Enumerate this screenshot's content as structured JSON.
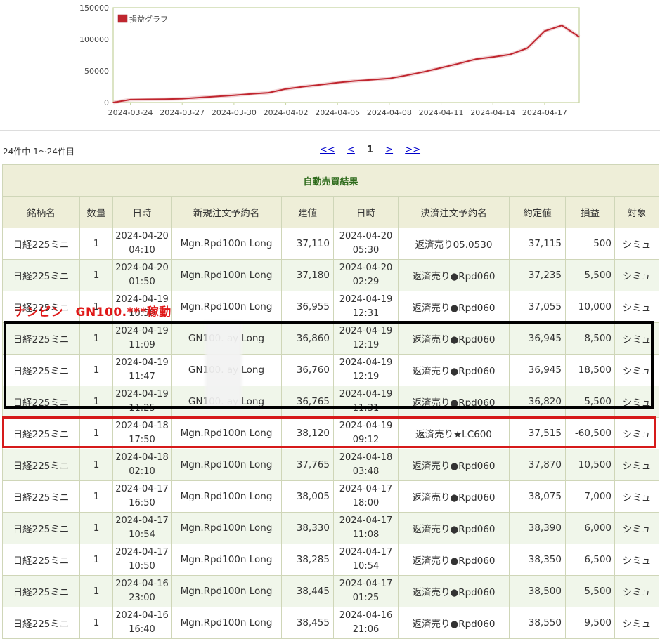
{
  "chart_data": {
    "type": "line",
    "title": "",
    "xlabel": "",
    "ylabel": "",
    "ylim": [
      0,
      150000
    ],
    "yticks": [
      "150000",
      "100000",
      "50000",
      "0"
    ],
    "xticks": [
      "2024-03-24",
      "2024-03-27",
      "2024-03-30",
      "2024-04-02",
      "2024-04-05",
      "2024-04-08",
      "2024-04-11",
      "2024-04-14",
      "2024-04-17"
    ],
    "grid": false,
    "legend": "top-left",
    "series": [
      {
        "name": "損益グラフ",
        "color": "#c0262f",
        "x": [
          "2024-03-23",
          "2024-03-24",
          "2024-03-25",
          "2024-03-26",
          "2024-03-27",
          "2024-03-28",
          "2024-03-29",
          "2024-03-30",
          "2024-03-31",
          "2024-04-01",
          "2024-04-02",
          "2024-04-03",
          "2024-04-04",
          "2024-04-05",
          "2024-04-06",
          "2024-04-07",
          "2024-04-08",
          "2024-04-09",
          "2024-04-10",
          "2024-04-11",
          "2024-04-12",
          "2024-04-13",
          "2024-04-14",
          "2024-04-15",
          "2024-04-16",
          "2024-04-17",
          "2024-04-18",
          "2024-04-19"
        ],
        "values": [
          0,
          4500,
          5000,
          5200,
          6000,
          7800,
          9500,
          11500,
          13500,
          15500,
          21500,
          25000,
          28000,
          31500,
          34000,
          36000,
          38000,
          43000,
          48500,
          55000,
          61500,
          68500,
          72000,
          76000,
          86000,
          113000,
          122000,
          104000
        ]
      }
    ]
  },
  "list": {
    "count_text": "24件中 1～24件目",
    "pager": {
      "first": "<<",
      "prev": "<",
      "current": "1",
      "next": ">",
      "last": ">>"
    }
  },
  "table": {
    "caption": "自動売買結果",
    "headers": [
      "銘柄名",
      "数量",
      "日時",
      "新規注文予約名",
      "建値",
      "日時",
      "決済注文予約名",
      "約定値",
      "損益",
      "対象"
    ],
    "rows": [
      {
        "symbol": "日経225ミニ",
        "qty": "1",
        "open_date": "2024-04-20",
        "open_time": "04:10",
        "entry_name": "Mgn.Rpd100n Long",
        "entry_price": "37,110",
        "close_date": "2024-04-20",
        "close_time": "05:30",
        "exit_name": "返済売り05.0530",
        "exit_price": "37,115",
        "pl": "500",
        "target": "シミュ"
      },
      {
        "symbol": "日経225ミニ",
        "qty": "1",
        "open_date": "2024-04-20",
        "open_time": "01:50",
        "entry_name": "Mgn.Rpd100n Long",
        "entry_price": "37,180",
        "close_date": "2024-04-20",
        "close_time": "02:29",
        "exit_name": "返済売り●Rpd060",
        "exit_price": "37,235",
        "pl": "5,500",
        "target": "シミュ"
      },
      {
        "symbol": "日経225ミニ",
        "qty": "1",
        "open_date": "2024-04-19",
        "open_time": "10:50",
        "entry_name": "Mgn.Rpd100n Long",
        "entry_price": "36,955",
        "close_date": "2024-04-19",
        "close_time": "12:31",
        "exit_name": "返済売り●Rpd060",
        "exit_price": "37,055",
        "pl": "10,000",
        "target": "シミュ"
      },
      {
        "symbol": "日経225ミニ",
        "qty": "1",
        "open_date": "2024-04-19",
        "open_time": "11:09",
        "entry_name": "GN100.   ay Long",
        "entry_price": "36,860",
        "close_date": "2024-04-19",
        "close_time": "12:19",
        "exit_name": "返済売り●Rpd060",
        "exit_price": "36,945",
        "pl": "8,500",
        "target": "シミュ"
      },
      {
        "symbol": "日経225ミニ",
        "qty": "1",
        "open_date": "2024-04-19",
        "open_time": "11:47",
        "entry_name": "GN100.   ay Long",
        "entry_price": "36,760",
        "close_date": "2024-04-19",
        "close_time": "12:19",
        "exit_name": "返済売り●Rpd060",
        "exit_price": "36,945",
        "pl": "18,500",
        "target": "シミュ"
      },
      {
        "symbol": "日経225ミニ",
        "qty": "1",
        "open_date": "2024-04-19",
        "open_time": "11:25",
        "entry_name": "GN100.   ay Long",
        "entry_price": "36,765",
        "close_date": "2024-04-19",
        "close_time": "11:31",
        "exit_name": "返済売り●Rpd060",
        "exit_price": "36,820",
        "pl": "5,500",
        "target": "シミュ"
      },
      {
        "symbol": "日経225ミニ",
        "qty": "1",
        "open_date": "2024-04-18",
        "open_time": "17:50",
        "entry_name": "Mgn.Rpd100n Long",
        "entry_price": "38,120",
        "close_date": "2024-04-19",
        "close_time": "09:12",
        "exit_name": "返済売り★LC600",
        "exit_price": "37,515",
        "pl": "-60,500",
        "target": "シミュ"
      },
      {
        "symbol": "日経225ミニ",
        "qty": "1",
        "open_date": "2024-04-18",
        "open_time": "02:10",
        "entry_name": "Mgn.Rpd100n Long",
        "entry_price": "37,765",
        "close_date": "2024-04-18",
        "close_time": "03:48",
        "exit_name": "返済売り●Rpd060",
        "exit_price": "37,870",
        "pl": "10,500",
        "target": "シミュ"
      },
      {
        "symbol": "日経225ミニ",
        "qty": "1",
        "open_date": "2024-04-17",
        "open_time": "16:50",
        "entry_name": "Mgn.Rpd100n Long",
        "entry_price": "38,005",
        "close_date": "2024-04-17",
        "close_time": "18:00",
        "exit_name": "返済売り●Rpd060",
        "exit_price": "38,075",
        "pl": "7,000",
        "target": "シミュ"
      },
      {
        "symbol": "日経225ミニ",
        "qty": "1",
        "open_date": "2024-04-17",
        "open_time": "10:54",
        "entry_name": "Mgn.Rpd100n Long",
        "entry_price": "38,330",
        "close_date": "2024-04-17",
        "close_time": "11:08",
        "exit_name": "返済売り●Rpd060",
        "exit_price": "38,390",
        "pl": "6,000",
        "target": "シミュ"
      },
      {
        "symbol": "日経225ミニ",
        "qty": "1",
        "open_date": "2024-04-17",
        "open_time": "10:50",
        "entry_name": "Mgn.Rpd100n Long",
        "entry_price": "38,285",
        "close_date": "2024-04-17",
        "close_time": "10:54",
        "exit_name": "返済売り●Rpd060",
        "exit_price": "38,350",
        "pl": "6,500",
        "target": "シミュ"
      },
      {
        "symbol": "日経225ミニ",
        "qty": "1",
        "open_date": "2024-04-16",
        "open_time": "23:00",
        "entry_name": "Mgn.Rpd100n Long",
        "entry_price": "38,445",
        "close_date": "2024-04-17",
        "close_time": "01:25",
        "exit_name": "返済売り●Rpd060",
        "exit_price": "38,500",
        "pl": "5,500",
        "target": "シミュ"
      },
      {
        "symbol": "日経225ミニ",
        "qty": "1",
        "open_date": "2024-04-16",
        "open_time": "16:40",
        "entry_name": "Mgn.Rpd100n Long",
        "entry_price": "38,455",
        "close_date": "2024-04-16",
        "close_time": "21:06",
        "exit_name": "返済売り●Rpd060",
        "exit_price": "38,550",
        "pl": "9,500",
        "target": "シミュ"
      }
    ]
  },
  "overlay": {
    "annotation": "ナンピン　GN100.***稼動",
    "black_box_color": "#000000",
    "red_box_color": "#d61a1a"
  },
  "colors": {
    "profit": "#d62020",
    "loss": "#2e8b2e",
    "header_bg": "#eeeed8",
    "alt_row_bg": "#f0f6ea",
    "caption_text": "#2e6b1c",
    "link": "#0000cc"
  }
}
